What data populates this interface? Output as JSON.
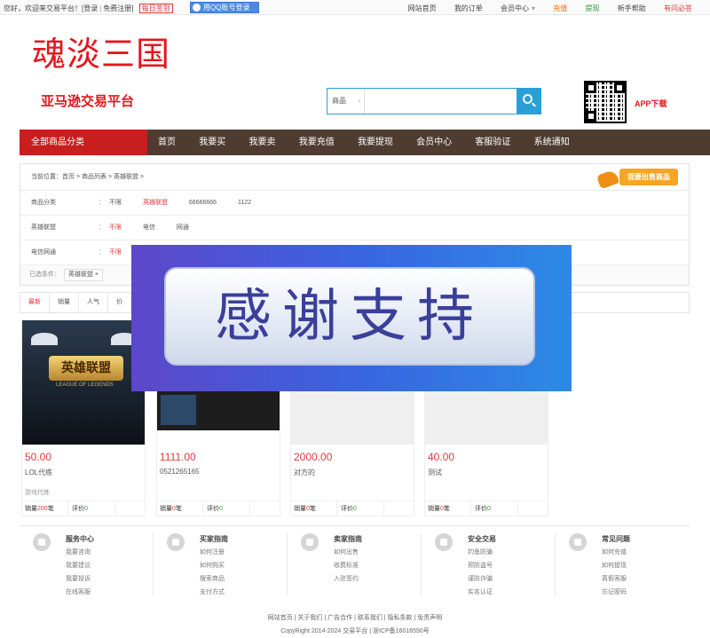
{
  "topbar": {
    "greeting": "您好，欢迎来交易平台！",
    "login": "[登录",
    "register": "免费注册]",
    "checkin": "每日签到",
    "qq_login": "用QQ账号登录",
    "links": [
      "网站首页",
      "我的订单",
      "会员中心",
      "充值",
      "提现",
      "新手帮助",
      "有问必答"
    ]
  },
  "header": {
    "logo": "魂淡三国",
    "subtitle": "亚马逊交易平台",
    "search": {
      "select": "商品",
      "placeholder": ""
    },
    "app_download": "APP下载"
  },
  "nav": {
    "category": "全部商品分类",
    "items": [
      "首页",
      "我要买",
      "我要卖",
      "我要充值",
      "我要提现",
      "会员中心",
      "客服验证",
      "系统通知"
    ]
  },
  "breadcrumb": "当前位置：首页 > 商品列表 > 英雄联盟 >",
  "sell_button": "我要出售商品",
  "filters": [
    {
      "label": "商品分类",
      "values": [
        "不限",
        "英雄联盟",
        "66666666",
        "1122"
      ],
      "active": 1
    },
    {
      "label": "英雄联盟",
      "values": [
        "不限",
        "电信",
        "网通"
      ],
      "active": 0
    },
    {
      "label": "电信网通",
      "values": [
        "不限"
      ],
      "active": 0
    }
  ],
  "conditions": {
    "label": "已选条件：",
    "tag": "英雄联盟 ×"
  },
  "sort": [
    "最新",
    "销量",
    "人气",
    "价"
  ],
  "products": [
    {
      "price": "50.00",
      "name": "LOL代练",
      "extra": "游戏代练",
      "sales_label": "销量",
      "sales": "200",
      "sales_unit": "笔",
      "rating_label": "评价",
      "rating": "0",
      "image_title": "英雄联盟",
      "image_sub": "LEAGUE OF LEGENDS"
    },
    {
      "price": "1111.00",
      "name": "0521265165",
      "extra": "",
      "sales_label": "销量",
      "sales": "0",
      "sales_unit": "笔",
      "rating_label": "评价",
      "rating": "0"
    },
    {
      "price": "2000.00",
      "name": "对方的",
      "extra": "",
      "sales_label": "销量",
      "sales": "0",
      "sales_unit": "笔",
      "rating_label": "评价",
      "rating": "0"
    },
    {
      "price": "40.00",
      "name": "测试",
      "extra": "",
      "sales_label": "销量",
      "sales": "0",
      "sales_unit": "笔",
      "rating_label": "评价",
      "rating": "0"
    }
  ],
  "overlay_text": "感谢支持",
  "footer": {
    "columns": [
      {
        "title": "服务中心",
        "links": [
          "我要咨询",
          "我要建议",
          "我要投诉",
          "在线客服"
        ],
        "icon": "edit-icon"
      },
      {
        "title": "买家指南",
        "links": [
          "如何注册",
          "如何购买",
          "搜索商品",
          "支付方式"
        ],
        "icon": "cart-icon"
      },
      {
        "title": "卖家指南",
        "links": [
          "如何出售",
          "收费标准",
          "入驻签约"
        ],
        "icon": "mail-icon"
      },
      {
        "title": "安全交易",
        "links": [
          "钓鱼防骗",
          "预防盗号",
          "谨防诈骗",
          "实名认证"
        ],
        "icon": "lock-icon"
      },
      {
        "title": "常见问题",
        "links": [
          "如何充值",
          "如何提现",
          "真假客服",
          "忘记密码"
        ],
        "icon": "heart-icon"
      }
    ],
    "links_line": "网站首页 | 关于我们 | 广告合作 | 联系我们 | 隐私条款 | 免责声明",
    "copyright": "CopyRight 2014-2024 交易平台 | 浙ICP备16016550号"
  }
}
